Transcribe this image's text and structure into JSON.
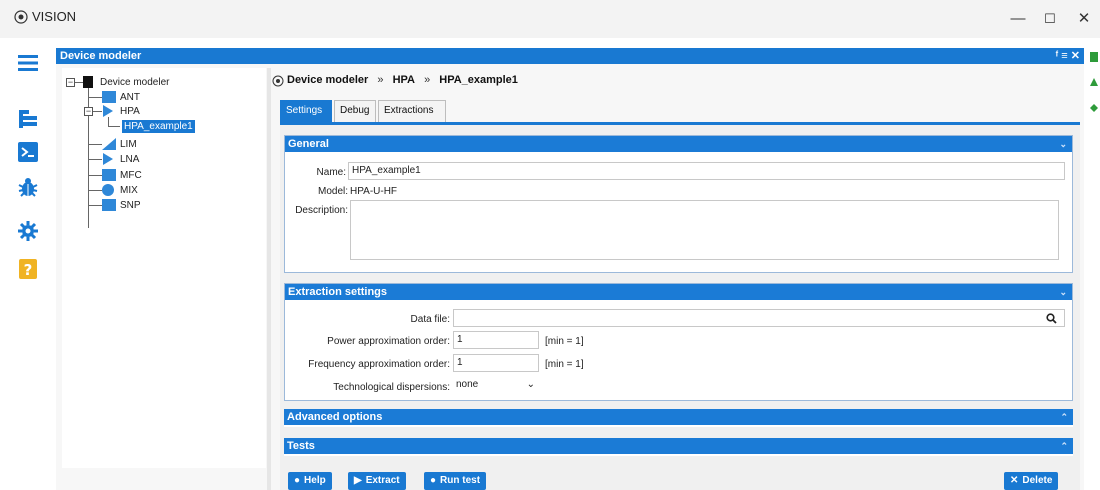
{
  "window": {
    "title": "VISION",
    "controls": {
      "minimize": "—",
      "maximize": "☐",
      "close": "✕"
    }
  },
  "rail": {
    "icons": [
      "menu-icon",
      "files-icon",
      "terminal-icon",
      "bug-icon",
      "gear-icon",
      "help-icon"
    ]
  },
  "device_modeler": {
    "title": "Device modeler",
    "header_controls": "ᶠ ≡ ✕"
  },
  "tree": {
    "root": "Device modeler",
    "items": [
      "ANT",
      "HPA",
      "HPA_example1",
      "LIM",
      "LNA",
      "MFC",
      "MIX",
      "SNP"
    ],
    "selected": "HPA_example1"
  },
  "breadcrumb": {
    "parts": [
      "Device modeler",
      "HPA",
      "HPA_example1"
    ],
    "separator": "»"
  },
  "tabs": [
    "Settings",
    "Debug",
    "Extractions"
  ],
  "general": {
    "title": "General",
    "name_label": "Name:",
    "name_value": "HPA_example1",
    "model_label": "Model:",
    "model_value": "HPA-U-HF",
    "description_label": "Description:",
    "description_value": ""
  },
  "extraction": {
    "title": "Extraction settings",
    "data_file_label": "Data file:",
    "data_file_value": "",
    "power_label": "Power approximation order:",
    "power_value": "1",
    "power_hint": "[min = 1]",
    "freq_label": "Frequency approximation order:",
    "freq_value": "1",
    "freq_hint": "[min = 1]",
    "tech_label": "Technological dispersions:",
    "tech_value": "none"
  },
  "advanced": {
    "title": "Advanced options"
  },
  "tests": {
    "title": "Tests"
  },
  "buttons": {
    "help": "Help",
    "extract": "Extract",
    "run_test": "Run test",
    "delete": "Delete"
  },
  "colors": {
    "accent": "#1979d2",
    "section_header": "#1b7bd6"
  }
}
